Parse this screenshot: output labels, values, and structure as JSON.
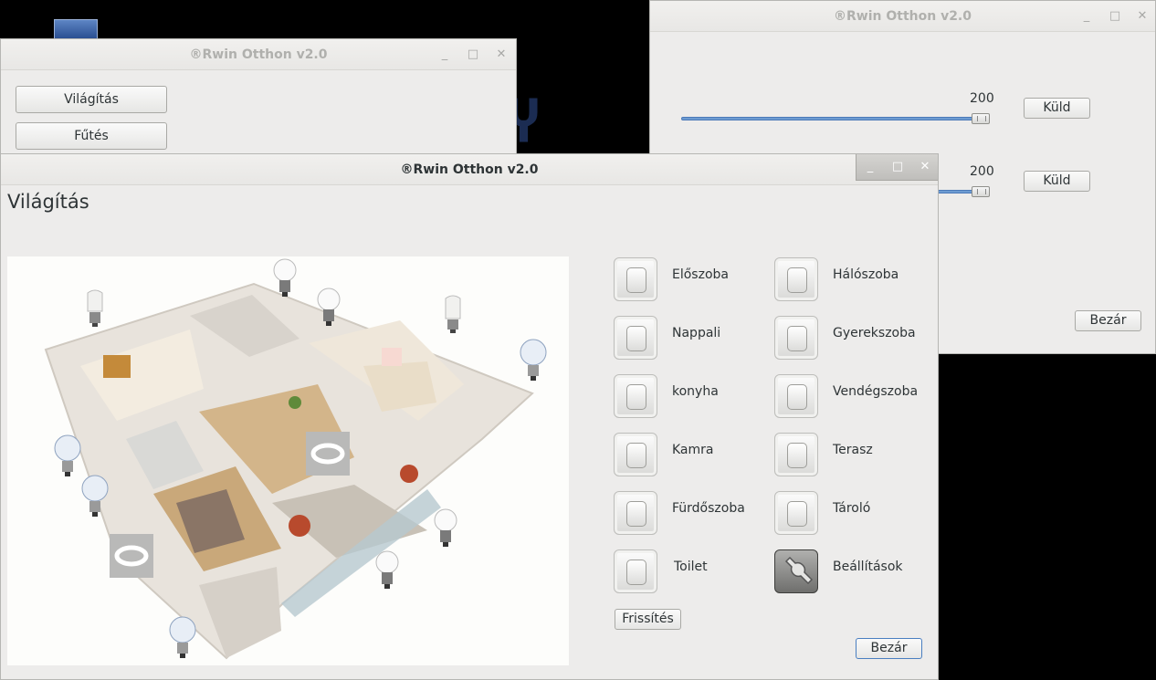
{
  "menu_window": {
    "title": "®Rwin Otthon v2.0",
    "buttons": [
      "Világítás",
      "Fűtés"
    ]
  },
  "slider_window": {
    "title": "®Rwin Otthon v2.0",
    "sliders": [
      {
        "value": "200",
        "send_label": "Küld"
      },
      {
        "value": "200",
        "send_label": "Küld"
      }
    ],
    "close_label": "Bezár"
  },
  "main_window": {
    "title": "®Rwin Otthon v2.0",
    "heading": "Világítás",
    "rooms_left": [
      "Előszoba",
      "Nappali",
      "konyha",
      "Kamra",
      "Fürdőszoba",
      "Toilet"
    ],
    "rooms_right": [
      "Hálószoba",
      "Gyerekszoba",
      "Vendégszoba",
      "Terasz",
      "Tároló"
    ],
    "settings_label": "Beállítások",
    "refresh_label": "Frissítés",
    "close_label": "Bezár"
  },
  "icons": {
    "minimize": "minimize-icon",
    "maximize": "maximize-icon",
    "close": "close-icon",
    "bulb": "light-bulb-icon",
    "led_strip": "led-strip-icon",
    "settings": "wrench-icon"
  }
}
